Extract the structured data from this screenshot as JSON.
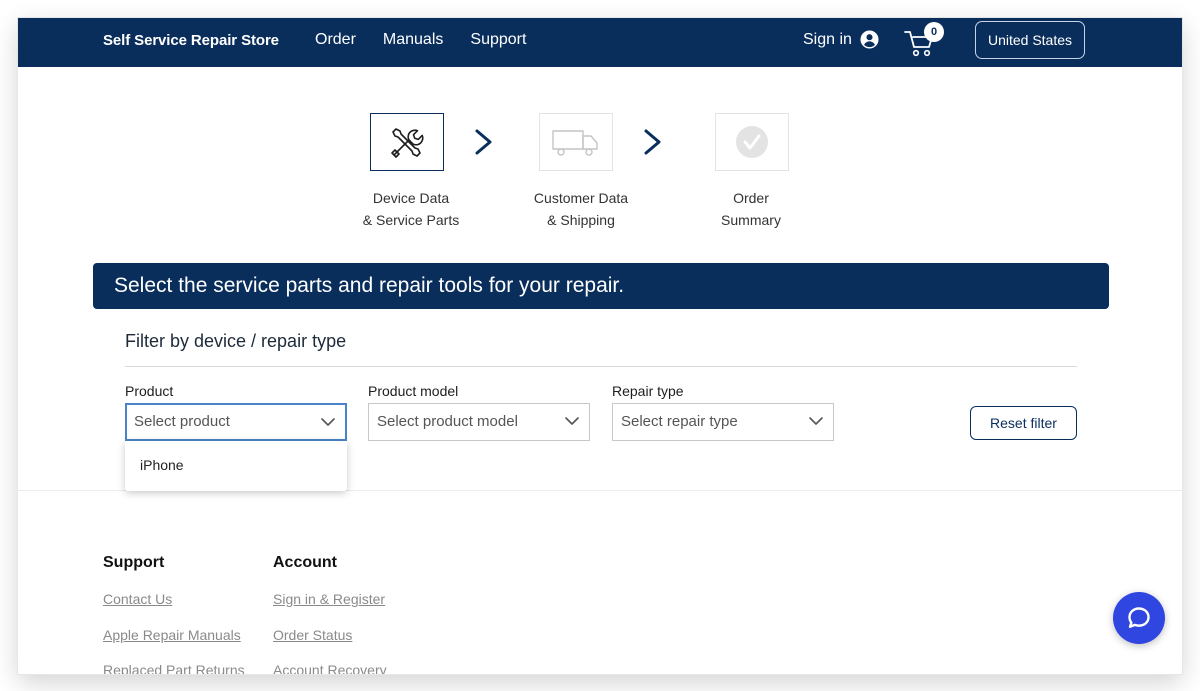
{
  "header": {
    "brand": "Self Service Repair Store",
    "nav": [
      "Order",
      "Manuals",
      "Support"
    ],
    "signin_label": "Sign in",
    "cart_count": "0",
    "country_label": "United States"
  },
  "stepper": {
    "steps": [
      {
        "line1": "Device Data",
        "line2": "& Service Parts",
        "state": "active",
        "icon": "tools-icon"
      },
      {
        "line1": "Customer Data",
        "line2": "& Shipping",
        "state": "inactive",
        "icon": "truck-icon"
      },
      {
        "line1": "Order",
        "line2": "Summary",
        "state": "inactive",
        "icon": "check-icon"
      }
    ]
  },
  "banner": {
    "text": "Select the service parts and repair tools for your repair."
  },
  "filter": {
    "title": "Filter by device / repair type",
    "fields": [
      {
        "label": "Product",
        "placeholder": "Select product",
        "focused": true
      },
      {
        "label": "Product model",
        "placeholder": "Select product model",
        "focused": false
      },
      {
        "label": "Repair type",
        "placeholder": "Select repair type",
        "focused": false
      }
    ],
    "reset_label": "Reset filter",
    "dropdown_options": [
      "iPhone"
    ]
  },
  "footer": {
    "columns": [
      {
        "heading": "Support",
        "links": [
          "Contact Us",
          "Apple Repair Manuals",
          "Replaced Part Returns"
        ]
      },
      {
        "heading": "Account",
        "links": [
          "Sign in & Register",
          "Order Status",
          "Account Recovery"
        ]
      }
    ]
  },
  "colors": {
    "navy": "#0a2e5c",
    "chat_blue": "#2f46e0",
    "focus_blue": "#4a83c8"
  }
}
